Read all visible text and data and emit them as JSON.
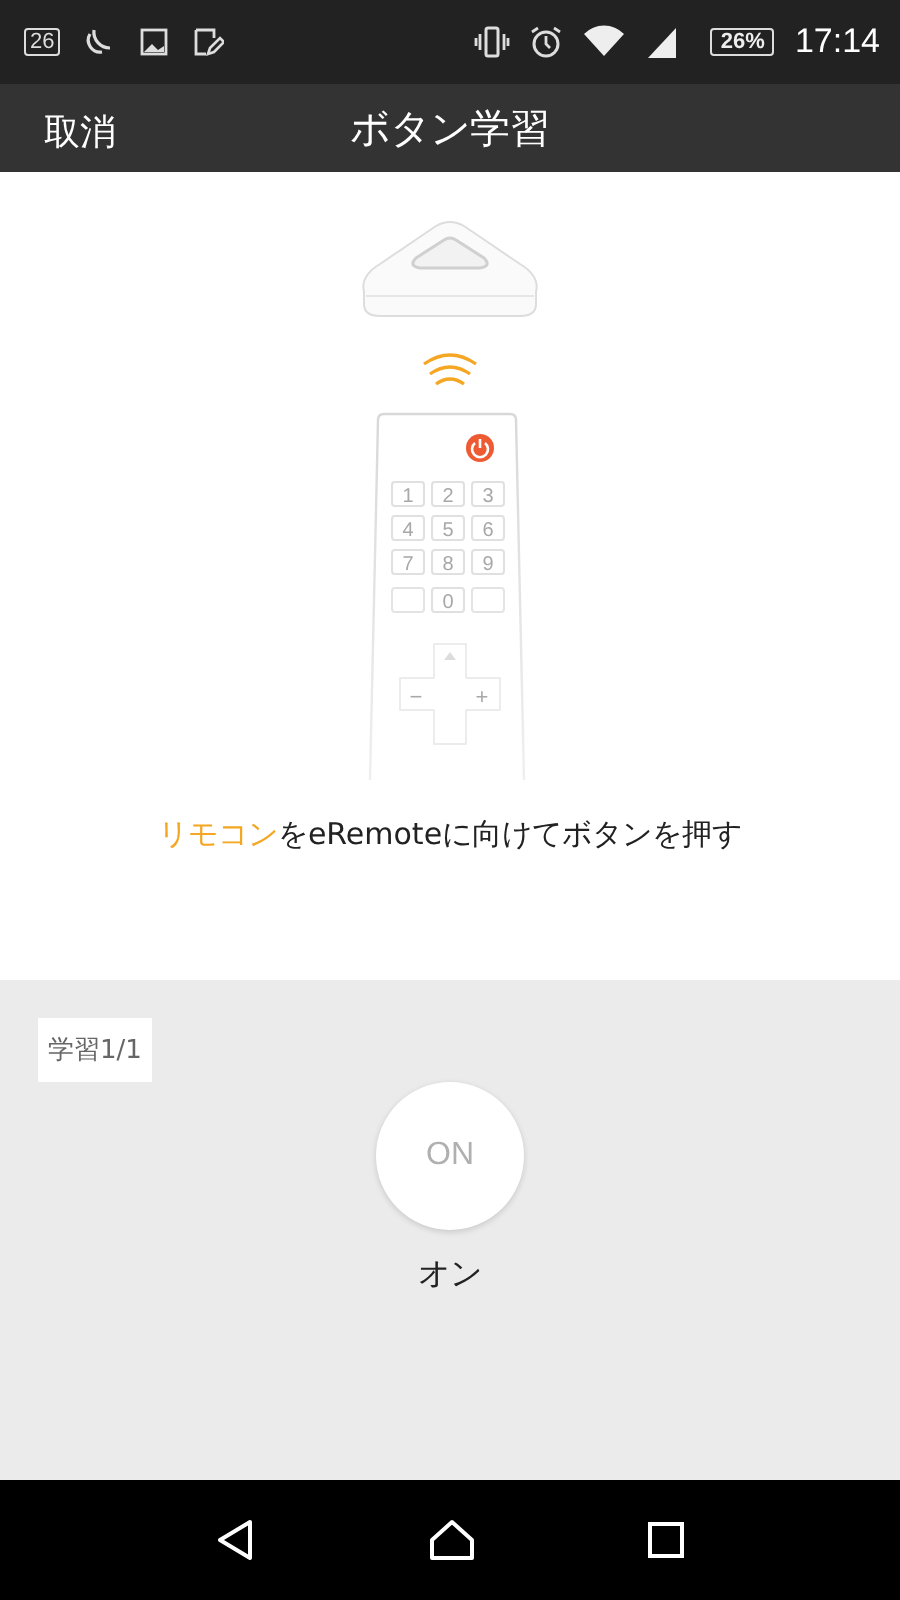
{
  "status_bar": {
    "notification_badge": "26",
    "battery": "26%",
    "time": "17:14"
  },
  "header": {
    "cancel": "取消",
    "title": "ボタン学習"
  },
  "remote_keys": [
    "1",
    "2",
    "3",
    "4",
    "5",
    "6",
    "7",
    "8",
    "9",
    "0"
  ],
  "dpad": {
    "minus": "−",
    "plus": "+"
  },
  "instruction": {
    "highlight": "リモコン",
    "text": "をeRemoteに向けてボタンを押す"
  },
  "learning": {
    "progress": "学習1/1",
    "button": "ON",
    "label": "オン"
  }
}
